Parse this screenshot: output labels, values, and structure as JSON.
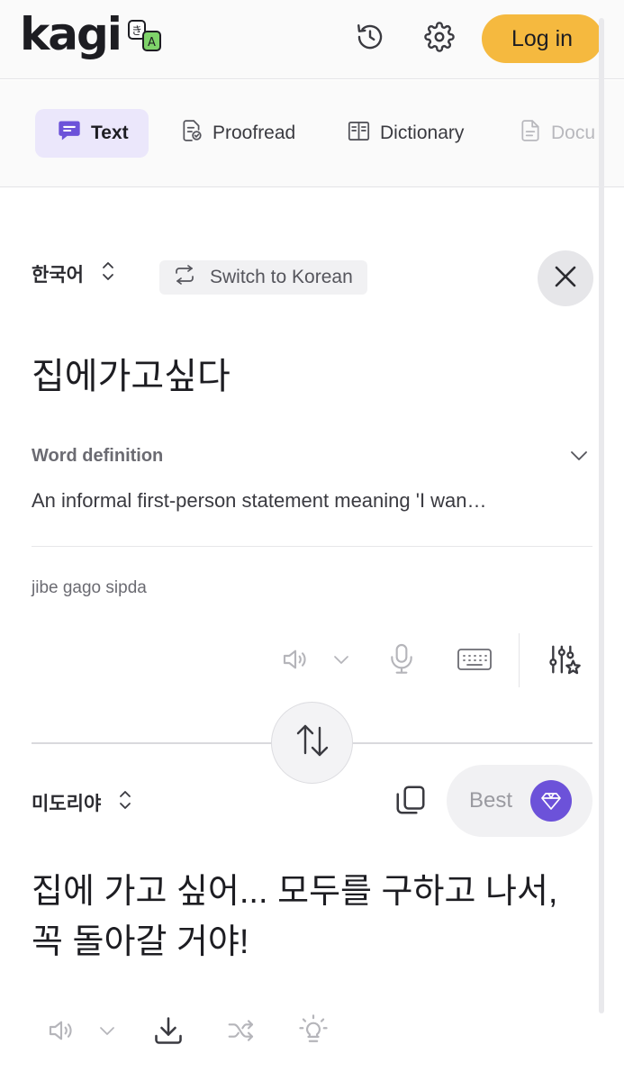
{
  "header": {
    "logo_text": "kagi",
    "logo_badge_glyphs": [
      "き",
      "A"
    ],
    "history_icon": "history-icon",
    "settings_icon": "gear-icon",
    "login_label": "Log in",
    "accent_color": "#f5b93f"
  },
  "tabs": [
    {
      "label": "Text",
      "icon": "chat-icon",
      "active": true
    },
    {
      "label": "Proofread",
      "icon": "proofread-icon",
      "active": false
    },
    {
      "label": "Dictionary",
      "icon": "book-icon",
      "active": false
    },
    {
      "label": "Docu",
      "icon": "document-icon",
      "active": false
    }
  ],
  "source": {
    "language": "한국어",
    "switch_label": "Switch to Korean",
    "text": "집에가고싶다",
    "definition_label": "Word definition",
    "definition_text": "An informal first-person statement meaning 'I wan…",
    "romanization": "jibe gago sipda"
  },
  "target": {
    "language": "미도리야",
    "quality_label": "Best",
    "quality_color": "#6c52d9",
    "text": "집에 가고 싶어... 모두를 구하고 나서, 꼭 돌아갈 거야!"
  }
}
